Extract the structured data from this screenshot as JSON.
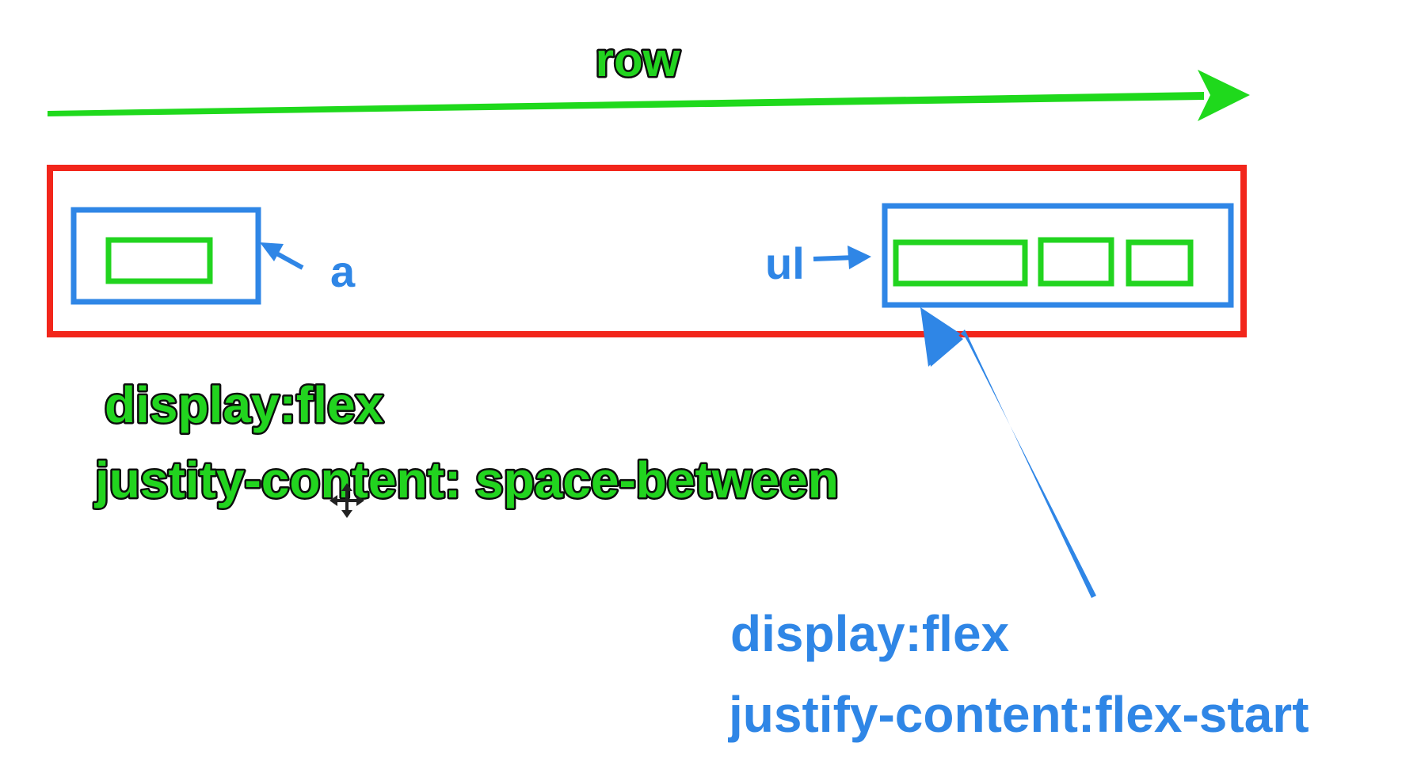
{
  "diagram": {
    "axis_label": "row",
    "element_a_label": "a",
    "element_ul_label": "ul",
    "parent_rule": {
      "line1": "display:flex",
      "line2": "justity-content: space-between"
    },
    "ul_rule": {
      "line1": "display:flex",
      "line2": "justify-content:flex-start"
    }
  },
  "colors": {
    "axis_arrow": "#1fd91c",
    "outer_container": "#f2261b",
    "flex_box": "#2f86e6",
    "flex_item": "#22d41f"
  },
  "icons": {
    "cursor": "move-cursor-icon"
  }
}
